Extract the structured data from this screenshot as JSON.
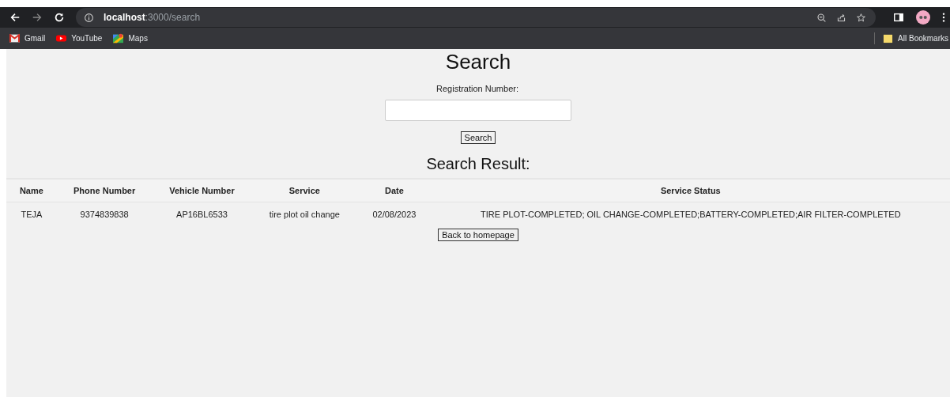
{
  "browser": {
    "address": {
      "host": "localhost",
      "path": ":3000/search"
    },
    "bookmarks": [
      {
        "label": "Gmail",
        "kind": "gmail"
      },
      {
        "label": "YouTube",
        "kind": "youtube"
      },
      {
        "label": "Maps",
        "kind": "maps"
      }
    ],
    "all_bookmarks": "All Bookmarks"
  },
  "page": {
    "title": "Search",
    "field_label": "Registration Number:",
    "search_button": "Search",
    "results_title": "Search Result:",
    "table": {
      "columns": [
        "Name",
        "Phone Number",
        "Vehicle Number",
        "Service",
        "Date",
        "Service Status"
      ],
      "rows": [
        [
          "TEJA",
          "9374839838",
          "AP16BL6533",
          "tire plot oil change",
          "02/08/2023",
          "TIRE PLOT-COMPLETED; OIL CHANGE-COMPLETED;BATTERY-COMPLETED;AIR FILTER-COMPLETED"
        ]
      ]
    },
    "back_button": "Back to homepage"
  }
}
